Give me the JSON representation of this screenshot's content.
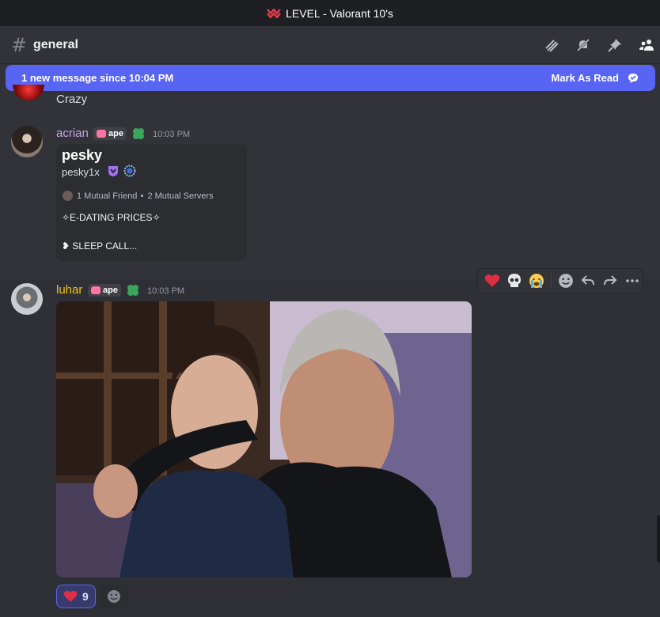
{
  "window": {
    "title": "LEVEL - Valorant 10's"
  },
  "channel": {
    "name": "general"
  },
  "banner": {
    "text": "1 new message since 10:04 PM",
    "action": "Mark As Read"
  },
  "messages": [
    {
      "text": "Crazy"
    },
    {
      "username": "acrian",
      "username_color": "#c9a3e6",
      "tag": "ape",
      "timestamp": "10:03 PM",
      "embed": {
        "title": "pesky",
        "handle": "pesky1x",
        "mutual_friends": "1 Mutual Friend",
        "mutual_servers": "2 Mutual Servers",
        "line1": "✧E-DATING PRICES✧",
        "line2": "❥ SLEEP CALL..."
      }
    },
    {
      "username": "luhar",
      "username_color": "#f0c419",
      "tag": "ape",
      "timestamp": "10:03 PM",
      "image": "photo-of-two-men",
      "reactions": [
        {
          "emoji": "heart",
          "count": "9"
        }
      ]
    }
  ],
  "toolbar": {
    "icons": [
      "heart-icon",
      "skull-icon",
      "crying-face-icon",
      "add-reaction-icon",
      "reply-icon",
      "forward-icon",
      "more-icon"
    ]
  },
  "colors": {
    "accent": "#5865f2",
    "background": "#313338"
  }
}
